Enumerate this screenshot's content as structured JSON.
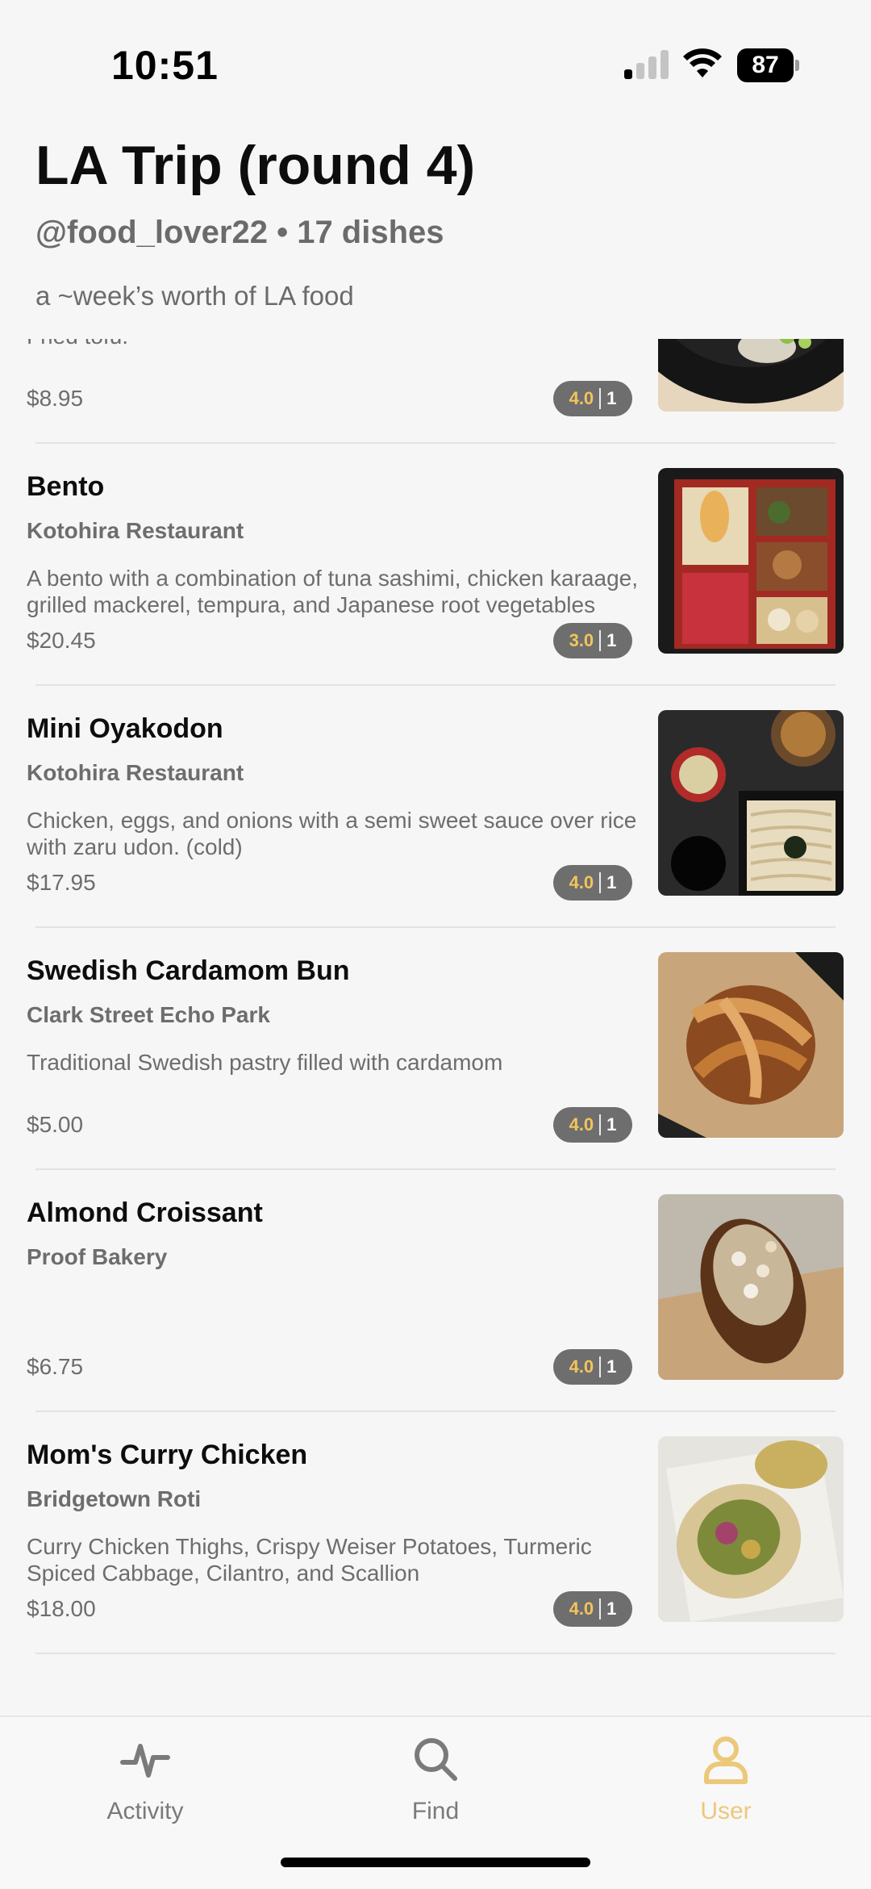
{
  "status_bar": {
    "time": "10:51",
    "battery": "87"
  },
  "header": {
    "title": "LA Trip (round 4)",
    "subtitle": "@food_lover22 • 17 dishes",
    "description": "a ~week’s worth of LA food"
  },
  "items": [
    {
      "name": "",
      "restaurant": "",
      "description": "Fried tofu.",
      "price": "$8.95",
      "rating": "4.0",
      "count": "1",
      "image": "tofu-photo"
    },
    {
      "name": "Bento",
      "restaurant": "Kotohira Restaurant",
      "description": "A bento with a combination of tuna sashimi, chicken karaage, grilled mackerel, tempura, and Japanese root vegetables",
      "price": "$20.45",
      "rating": "3.0",
      "count": "1",
      "image": "bento-photo"
    },
    {
      "name": "Mini Oyakodon",
      "restaurant": "Kotohira Restaurant",
      "description": "Chicken, eggs, and onions with a semi sweet sauce over rice with zaru udon. (cold)",
      "price": "$17.95",
      "rating": "4.0",
      "count": "1",
      "image": "oyakodon-photo"
    },
    {
      "name": "Swedish Cardamom Bun",
      "restaurant": "Clark Street Echo Park",
      "description": "Traditional Swedish pastry filled with cardamom",
      "price": "$5.00",
      "rating": "4.0",
      "count": "1",
      "image": "cardamom-bun-photo"
    },
    {
      "name": "Almond Croissant",
      "restaurant": "Proof Bakery",
      "description": "",
      "price": "$6.75",
      "rating": "4.0",
      "count": "1",
      "image": "croissant-photo"
    },
    {
      "name": "Mom's Curry Chicken",
      "restaurant": "Bridgetown Roti",
      "description": "Curry Chicken Thighs, Crispy Weiser Potatoes, Turmeric Spiced Cabbage, Cilantro, and Scallion",
      "price": "$18.00",
      "rating": "4.0",
      "count": "1",
      "image": "roti-photo"
    }
  ],
  "tabs": [
    {
      "label": "Activity",
      "icon": "activity-icon"
    },
    {
      "label": "Find",
      "icon": "search-icon"
    },
    {
      "label": "User",
      "icon": "user-icon",
      "active": true
    }
  ],
  "colors": {
    "accent": "#ecc87a",
    "rating_score": "#f2c45a",
    "badge_bg": "#6e6e6e"
  }
}
